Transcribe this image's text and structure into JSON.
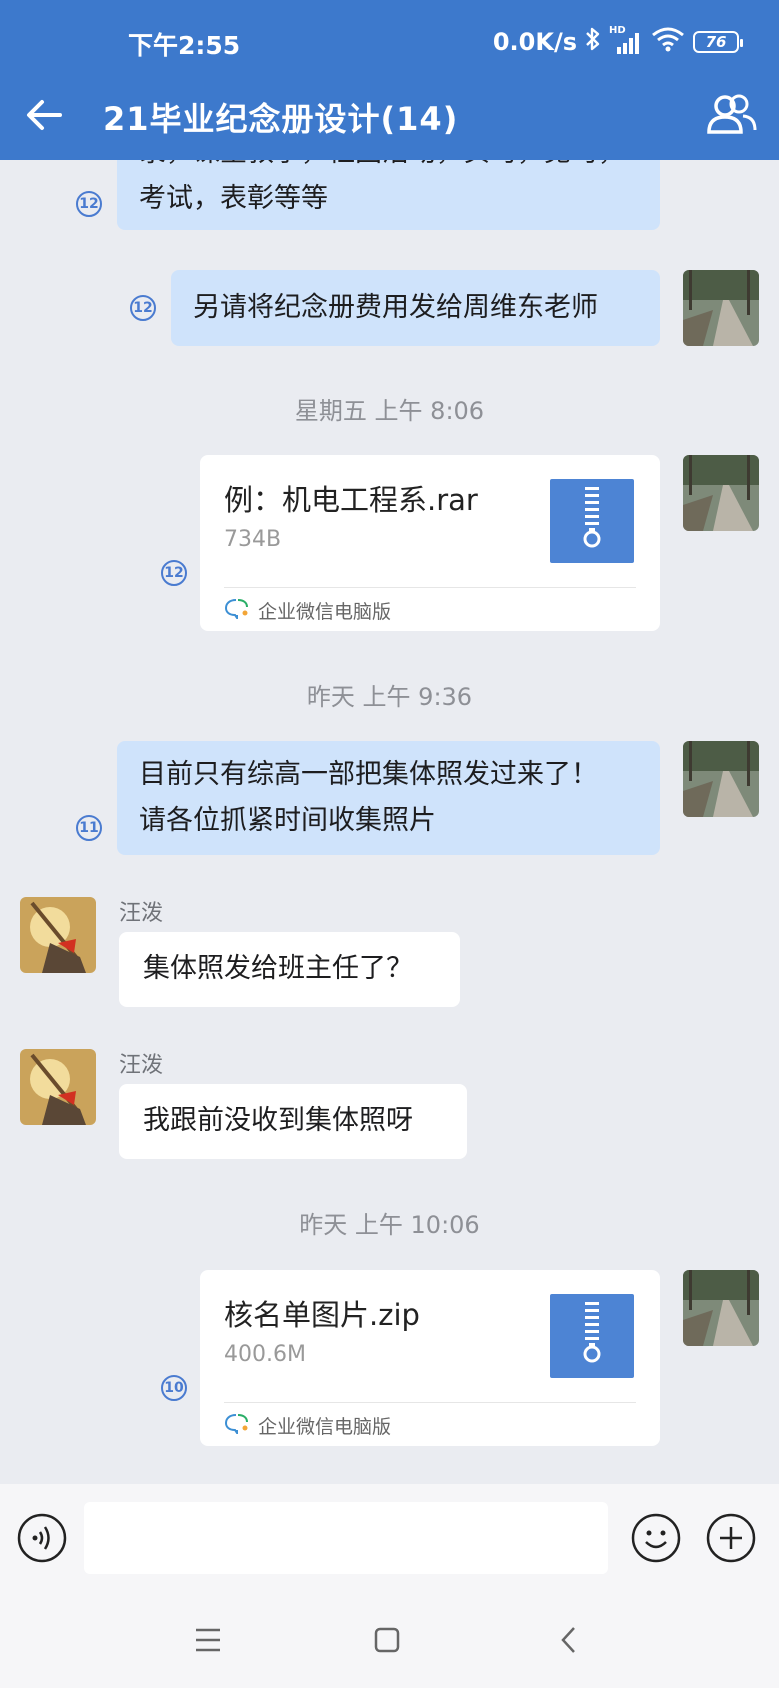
{
  "status_bar": {
    "time": "下午2:55",
    "network_speed": "0.0K/s",
    "signal_label": "HD",
    "battery": "76"
  },
  "header": {
    "title": "21毕业纪念册设计(14)",
    "back_icon": "back-arrow-icon",
    "members_icon": "group-members-icon",
    "background_color": "#3d79cc"
  },
  "messages": [
    {
      "type": "text",
      "direction": "outgoing",
      "partial_line": "录，课堂教学，社团活动，实习，见习，",
      "text": "考试，表彰等等",
      "unread": "12"
    },
    {
      "type": "text",
      "direction": "outgoing",
      "text": "另请将纪念册费用发给周维东老师",
      "unread": "12"
    },
    {
      "type": "timestamp",
      "text": "星期五  上午 8:06"
    },
    {
      "type": "file",
      "direction": "outgoing",
      "file_name": "例：机电工程系.rar",
      "file_size": "734B",
      "source": "企业微信电脑版",
      "unread": "12"
    },
    {
      "type": "timestamp",
      "text": "昨天  上午 9:36"
    },
    {
      "type": "text",
      "direction": "outgoing",
      "line1": "目前只有综高一部把集体照发过来了！",
      "line2": "请各位抓紧时间收集照片",
      "unread": "11"
    },
    {
      "type": "text",
      "direction": "incoming",
      "sender": "汪泼",
      "text": "集体照发给班主任了？"
    },
    {
      "type": "text",
      "direction": "incoming",
      "sender": "汪泼",
      "text": "我跟前没收到集体照呀"
    },
    {
      "type": "timestamp",
      "text": "昨天  上午 10:06"
    },
    {
      "type": "file",
      "direction": "outgoing",
      "file_name": "核名单图片.zip",
      "file_size": "400.6M",
      "source": "企业微信电脑版",
      "unread": "10"
    }
  ],
  "input_bar": {
    "placeholder": "",
    "voice_icon": "voice-input-icon",
    "emoji_icon": "emoji-icon",
    "plus_icon": "plus-icon"
  },
  "system_nav": {
    "menu_icon": "menu-icon",
    "home_icon": "home-square-icon",
    "back_icon": "back-chevron-icon"
  },
  "colors": {
    "outgoing_bubble": "#cfe3fb",
    "incoming_bubble": "#ffffff",
    "chat_background": "#eaecf1",
    "unread_badge": "#4a7bd0",
    "file_icon": "#4d84d4"
  }
}
